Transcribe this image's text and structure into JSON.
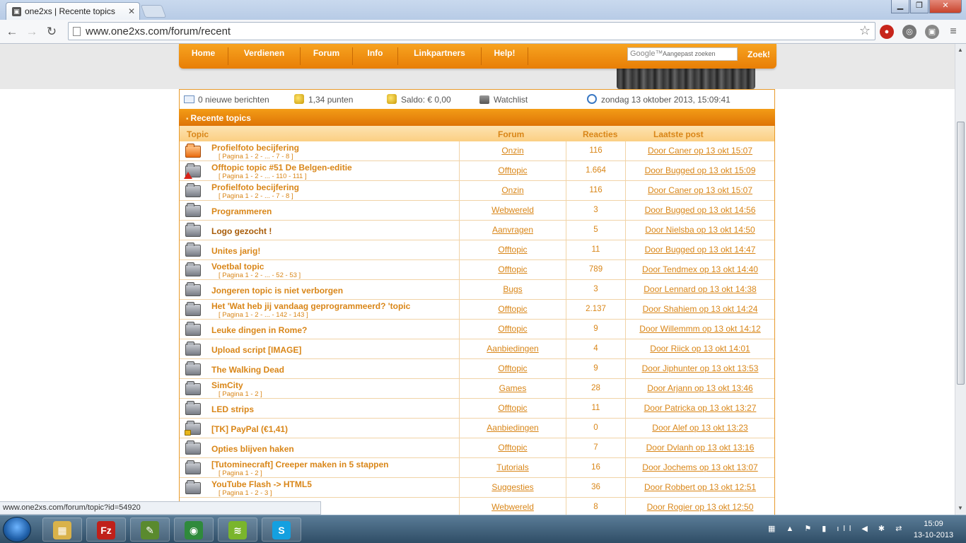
{
  "browser": {
    "tab_title": "one2xs | Recente topics",
    "url": "www.one2xs.com/forum/recent",
    "status_url": "www.one2xs.com/forum/topic?id=54920"
  },
  "nav": {
    "items": [
      "Home",
      "Verdienen",
      "Forum",
      "Info",
      "Linkpartners",
      "Help!"
    ],
    "search_placeholder": "Aangepast zoeken",
    "search_brand": "Google™",
    "search_button": "Zoek!"
  },
  "infobar": {
    "messages": "0 nieuwe berichten",
    "points": "1,34 punten",
    "balance": "Saldo: € 0,00",
    "watchlist": "Watchlist",
    "datetime": "zondag 13 oktober 2013, 15:09:41"
  },
  "section": {
    "title": "Recente topics"
  },
  "table": {
    "headers": {
      "topic": "Topic",
      "forum": "Forum",
      "reactions": "Reacties",
      "last_post": "Laatste post"
    },
    "rows": [
      {
        "title": "Profielfoto becijfering",
        "pages": "[ Pagina 1 - 2 - ... - 7 - 8 ]",
        "forum": "Onzin",
        "reactions": "116",
        "last": "Door Caner op 13 okt 15:07",
        "icon": "hot"
      },
      {
        "title": "Offtopic topic #51 De Belgen-editie",
        "pages": "[ Pagina 1 - 2 - ... - 110 - 111 ]",
        "forum": "Offtopic",
        "reactions": "1.664",
        "last": "Door Bugged op 13 okt 15:09",
        "icon": "alert"
      },
      {
        "title": "Profielfoto becijfering",
        "pages": "[ Pagina 1 - 2 - ... - 7 - 8 ]",
        "forum": "Onzin",
        "reactions": "116",
        "last": "Door Caner op 13 okt 15:07",
        "icon": "normal"
      },
      {
        "title": "Programmeren",
        "pages": "",
        "forum": "Webwereld",
        "reactions": "3",
        "last": "Door Bugged op 13 okt 14:56",
        "icon": "normal"
      },
      {
        "title": "Logo gezocht !",
        "pages": "",
        "forum": "Aanvragen",
        "reactions": "5",
        "last": "Door Nielsba op 13 okt 14:50",
        "icon": "normal"
      },
      {
        "title": "Unites jarig!",
        "pages": "",
        "forum": "Offtopic",
        "reactions": "11",
        "last": "Door Bugged op 13 okt 14:47",
        "icon": "normal"
      },
      {
        "title": "Voetbal topic",
        "pages": "[ Pagina 1 - 2 - ... - 52 - 53 ]",
        "forum": "Offtopic",
        "reactions": "789",
        "last": "Door Tendmex op 13 okt 14:40",
        "icon": "normal"
      },
      {
        "title": "Jongeren topic is niet verborgen",
        "pages": "",
        "forum": "Bugs",
        "reactions": "3",
        "last": "Door Lennard op 13 okt 14:38",
        "icon": "normal"
      },
      {
        "title": "Het 'Wat heb jij vandaag geprogrammeerd? 'topic",
        "pages": "[ Pagina 1 - 2 - ... - 142 - 143 ]",
        "forum": "Offtopic",
        "reactions": "2.137",
        "last": "Door Shahiem op 13 okt 14:24",
        "icon": "normal"
      },
      {
        "title": "Leuke dingen in Rome?",
        "pages": "",
        "forum": "Offtopic",
        "reactions": "9",
        "last": "Door Willemmm op 13 okt 14:12",
        "icon": "normal"
      },
      {
        "title": "Upload script [IMAGE]",
        "pages": "",
        "forum": "Aanbiedingen",
        "reactions": "4",
        "last": "Door Riick op 13 okt 14:01",
        "icon": "normal"
      },
      {
        "title": "The Walking Dead",
        "pages": "",
        "forum": "Offtopic",
        "reactions": "9",
        "last": "Door Jiphunter op 13 okt 13:53",
        "icon": "normal"
      },
      {
        "title": "SimCity",
        "pages": "[ Pagina 1 - 2 ]",
        "forum": "Games",
        "reactions": "28",
        "last": "Door Arjann op 13 okt 13:46",
        "icon": "normal"
      },
      {
        "title": "LED strips",
        "pages": "",
        "forum": "Offtopic",
        "reactions": "11",
        "last": "Door Patricka op 13 okt 13:27",
        "icon": "normal"
      },
      {
        "title": "[TK] PayPal (€1,41)",
        "pages": "",
        "forum": "Aanbiedingen",
        "reactions": "0",
        "last": "Door Alef op 13 okt 13:23",
        "icon": "lock"
      },
      {
        "title": "Opties blijven haken",
        "pages": "",
        "forum": "Offtopic",
        "reactions": "7",
        "last": "Door Dvlanh op 13 okt 13:16",
        "icon": "normal"
      },
      {
        "title": "[Tutominecraft] Creeper maken in 5 stappen",
        "pages": "[ Pagina 1 - 2 ]",
        "forum": "Tutorials",
        "reactions": "16",
        "last": "Door Jochems op 13 okt 13:07",
        "icon": "normal"
      },
      {
        "title": "YouTube Flash -> HTML5",
        "pages": "[ Pagina 1 - 2 - 3 ]",
        "forum": "Suggesties",
        "reactions": "36",
        "last": "Door Robbert op 13 okt 12:51",
        "icon": "normal"
      },
      {
        "title": "",
        "pages": "",
        "forum": "Webwereld",
        "reactions": "8",
        "last": "Door Rogier op 13 okt 12:50",
        "icon": "none"
      }
    ]
  },
  "taskbar": {
    "apps": [
      {
        "name": "explorer",
        "glyph": "▦",
        "color": "#d9b24a"
      },
      {
        "name": "filezilla",
        "glyph": "Fz",
        "color": "#c0201a"
      },
      {
        "name": "editor",
        "glyph": "✎",
        "color": "#5a8a2e"
      },
      {
        "name": "chrome",
        "glyph": "◉",
        "color": "#2f8a3c"
      },
      {
        "name": "spotify",
        "glyph": "≋",
        "color": "#7ab52c"
      },
      {
        "name": "skype",
        "glyph": "S",
        "color": "#14a0e0"
      }
    ],
    "time": "15:09",
    "date": "13-10-2013"
  }
}
